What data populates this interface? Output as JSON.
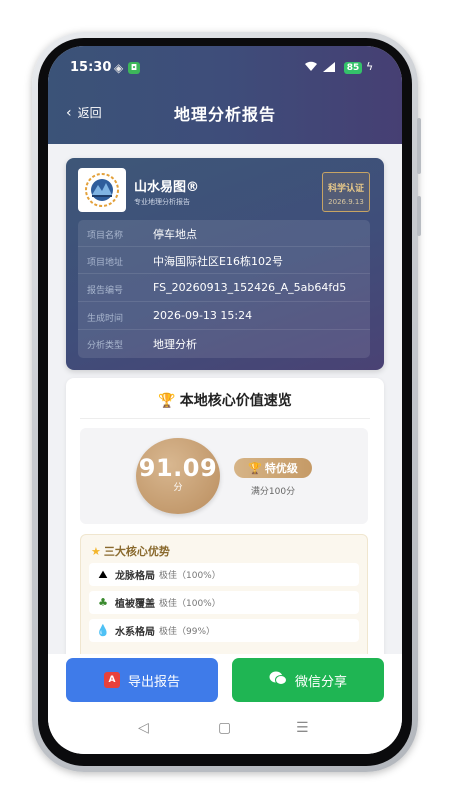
{
  "status": {
    "time": "15:30",
    "battery": "85"
  },
  "header": {
    "back_label": "返回",
    "title": "地理分析报告"
  },
  "report": {
    "brand_name": "山水易图®",
    "brand_sub": "专业地理分析报告",
    "cert_title": "科学认证",
    "cert_date": "2026.9.13",
    "info": [
      {
        "key": "项目名称",
        "value": "停车地点"
      },
      {
        "key": "项目地址",
        "value": "中海国际社区E16栋102号"
      },
      {
        "key": "报告编号",
        "value": "FS_20260913_152426_A_5ab64fd5"
      },
      {
        "key": "生成时间",
        "value": "2026-09-13 15:24"
      },
      {
        "key": "分析类型",
        "value": "地理分析"
      }
    ]
  },
  "core": {
    "title": "本地核心价值速览",
    "score": "91.09",
    "score_unit": "分",
    "grade": "特优级",
    "full_score": "满分100分",
    "advantages_title": "三大核心优势",
    "advantages": [
      {
        "icon": "mountain-icon",
        "label": "龙脉格局",
        "level": "极佳（100%）"
      },
      {
        "icon": "tree-icon",
        "label": "植被覆盖",
        "level": "极佳（100%）"
      },
      {
        "icon": "droplet-icon",
        "label": "水系格局",
        "level": "极佳（99%）"
      }
    ]
  },
  "actions": {
    "export_label": "导出报告",
    "share_label": "微信分享"
  },
  "colors": {
    "header_start": "#3b5378",
    "header_end": "#463f73",
    "gold": "#c39a6d",
    "export_blue": "#3f7be9",
    "share_green": "#1fb553"
  }
}
